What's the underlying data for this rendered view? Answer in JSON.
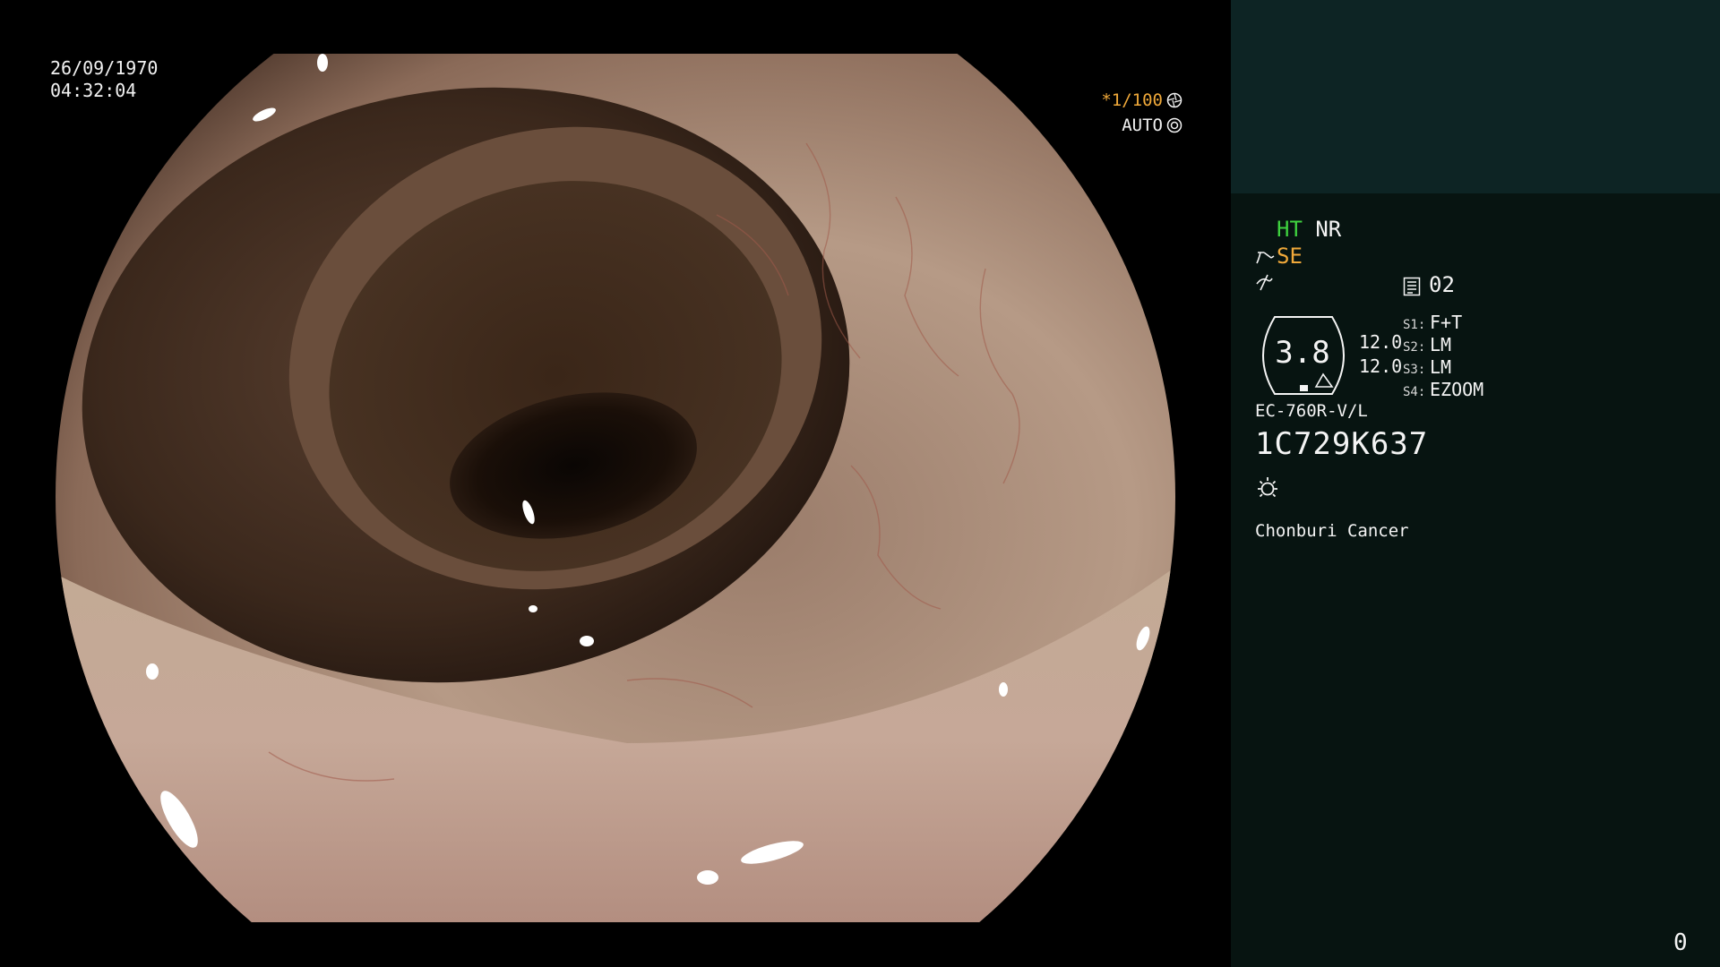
{
  "overlay": {
    "date": "26/09/1970",
    "time": "04:32:04",
    "shutter": "*1/100",
    "exposure_mode": "AUTO"
  },
  "panel": {
    "enhancement": {
      "ht": "HT",
      "nr": "NR",
      "se": "SE"
    },
    "mode_number": "02",
    "zoom": {
      "value": "3.8",
      "setting_1": "12.0",
      "setting_2": "12.0"
    },
    "switches": [
      {
        "key": "S1:",
        "value": "F+T"
      },
      {
        "key": "S2:",
        "value": "LM"
      },
      {
        "key": "S3:",
        "value": "LM"
      },
      {
        "key": "S4:",
        "value": "EZOOM"
      }
    ],
    "scope_model": "EC-760R-V/L",
    "scope_serial": "1C729K637",
    "hospital": "Chonburi Cancer",
    "counter": "0"
  },
  "colors": {
    "ht_color": "#3fd23f",
    "se_color": "#f0a93a",
    "shutter_color": "#f0a93a",
    "panel_top": "#0d2424",
    "panel_bg": "#071411"
  },
  "icons": [
    "aperture-icon",
    "iris-icon",
    "hook-icon",
    "flat-icon",
    "mode-icon",
    "light-icon"
  ]
}
